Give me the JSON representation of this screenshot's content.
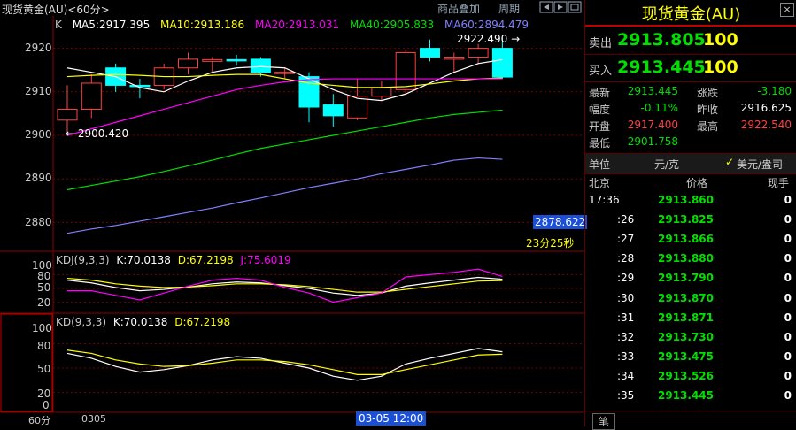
{
  "window": {
    "title": "现货黄金(AU)<60分>"
  },
  "toolbar": {
    "overlay_label": "商品叠加",
    "period_label": "周期"
  },
  "main_chart": {
    "k_label": "K",
    "ma_legend": [
      {
        "label": "MA5:2917.395",
        "color": "#ffffff"
      },
      {
        "label": "MA10:2913.186",
        "color": "#ffff00"
      },
      {
        "label": "MA20:2913.031",
        "color": "#ff00ff"
      },
      {
        "label": "MA40:2905.833",
        "color": "#00e000"
      },
      {
        "label": "MA60:2894.479",
        "color": "#8080ff"
      }
    ],
    "y_ticks": [
      "2920",
      "2910",
      "2900",
      "2890",
      "2880"
    ],
    "high_marker": "2922.490",
    "low_marker": "2900.420",
    "price_tag": "2878.622",
    "countdown": "23分25秒"
  },
  "kdj_panel": {
    "legend": [
      {
        "label": "KDJ(9,3,3)",
        "color": "#cccccc"
      },
      {
        "label": "K:70.0138",
        "color": "#ffffff"
      },
      {
        "label": "D:67.2198",
        "color": "#ffff00"
      },
      {
        "label": "J:75.6019",
        "color": "#ff00ff"
      }
    ],
    "y_ticks": [
      "100",
      "80",
      "50",
      "20"
    ]
  },
  "kd_panel": {
    "legend": [
      {
        "label": "KD(9,3,3)",
        "color": "#cccccc"
      },
      {
        "label": "K:70.0138",
        "color": "#ffffff"
      },
      {
        "label": "D:67.2198",
        "color": "#ffff00"
      }
    ],
    "y_ticks": [
      "100",
      "80",
      "50",
      "20",
      "0"
    ]
  },
  "x_axis": {
    "period": "60分",
    "date_label": "0305",
    "cursor_label": "03-05 12:00"
  },
  "quote": {
    "title": "现货黄金(AU)",
    "sell_label": "卖出",
    "sell_price": "2913.805",
    "sell_qty": "100",
    "buy_label": "买入",
    "buy_price": "2913.445",
    "buy_qty": "100",
    "stats": [
      {
        "l1": "最新",
        "v1": "2913.445",
        "c1": "#00e000",
        "l2": "涨跌",
        "v2": "-3.180",
        "c2": "#00e000"
      },
      {
        "l1": "幅度",
        "v1": "-0.11%",
        "c1": "#00e000",
        "l2": "昨收",
        "v2": "2916.625",
        "c2": "#ffffff"
      },
      {
        "l1": "开盘",
        "v1": "2917.400",
        "c1": "#ff4040",
        "l2": "最高",
        "v2": "2922.540",
        "c2": "#ff4040"
      },
      {
        "l1": "最低",
        "v1": "2901.758",
        "c1": "#00e000",
        "l2": "",
        "v2": "",
        "c2": "#ffffff"
      }
    ],
    "unit_label": "单位",
    "unit_value": "元/克",
    "usd_option": "美元/盎司",
    "ticks_header": {
      "time": "北京",
      "price": "价格",
      "vol": "现手"
    },
    "ticks": [
      {
        "time": "17:36",
        "price": "2913.860",
        "vol": "0"
      },
      {
        "time": ":26",
        "price": "2913.825",
        "vol": "0"
      },
      {
        "time": ":27",
        "price": "2913.866",
        "vol": "0"
      },
      {
        "time": ":28",
        "price": "2913.880",
        "vol": "0"
      },
      {
        "time": ":29",
        "price": "2913.790",
        "vol": "0"
      },
      {
        "time": ":30",
        "price": "2913.870",
        "vol": "0"
      },
      {
        "time": ":31",
        "price": "2913.871",
        "vol": "0"
      },
      {
        "time": ":32",
        "price": "2913.730",
        "vol": "0"
      },
      {
        "time": ":33",
        "price": "2913.475",
        "vol": "0"
      },
      {
        "time": ":34",
        "price": "2913.526",
        "vol": "0"
      },
      {
        "time": ":35",
        "price": "2913.445",
        "vol": "0"
      }
    ],
    "bottom_tab": "笔"
  },
  "colors": {
    "up": "#ff4040",
    "down": "#00ffff",
    "grid": "#7a0000",
    "axis": "#8b0000"
  },
  "chart_data": {
    "type": "candlestick",
    "title": "",
    "ylim": [
      2875,
      2925
    ],
    "candles": [
      {
        "o": 2903.5,
        "c": 2906.0,
        "h": 2911.5,
        "l": 2900.4
      },
      {
        "o": 2906.0,
        "c": 2912.0,
        "h": 2914.0,
        "l": 2904.0
      },
      {
        "o": 2915.5,
        "c": 2911.5,
        "h": 2916.5,
        "l": 2910.0
      },
      {
        "o": 2911.5,
        "c": 2911.2,
        "h": 2913.0,
        "l": 2908.5
      },
      {
        "o": 2911.5,
        "c": 2915.5,
        "h": 2916.5,
        "l": 2910.5
      },
      {
        "o": 2915.5,
        "c": 2917.5,
        "h": 2919.0,
        "l": 2914.0
      },
      {
        "o": 2917.0,
        "c": 2917.4,
        "h": 2918.0,
        "l": 2914.5
      },
      {
        "o": 2917.4,
        "c": 2917.2,
        "h": 2918.5,
        "l": 2916.0
      },
      {
        "o": 2917.5,
        "c": 2914.5,
        "h": 2918.0,
        "l": 2913.5
      },
      {
        "o": 2914.5,
        "c": 2914.5,
        "h": 2915.5,
        "l": 2913.0
      },
      {
        "o": 2913.5,
        "c": 2906.5,
        "h": 2914.5,
        "l": 2903.0
      },
      {
        "o": 2907.0,
        "c": 2904.5,
        "h": 2909.5,
        "l": 2902.0
      },
      {
        "o": 2904.0,
        "c": 2909.0,
        "h": 2913.0,
        "l": 2903.5
      },
      {
        "o": 2909.0,
        "c": 2911.0,
        "h": 2912.5,
        "l": 2908.0
      },
      {
        "o": 2910.5,
        "c": 2919.0,
        "h": 2919.5,
        "l": 2909.5
      },
      {
        "o": 2920.0,
        "c": 2918.0,
        "h": 2922.0,
        "l": 2917.0
      },
      {
        "o": 2917.5,
        "c": 2918.0,
        "h": 2919.0,
        "l": 2914.5
      },
      {
        "o": 2918.0,
        "c": 2920.0,
        "h": 2921.0,
        "l": 2916.5
      },
      {
        "o": 2920.0,
        "c": 2913.4,
        "h": 2922.5,
        "l": 2913.0
      }
    ],
    "ma": [
      {
        "name": "MA5",
        "color": "#ffffff",
        "values": [
          2915.5,
          2914.5,
          2913.5,
          2911.0,
          2910.0,
          2912.5,
          2914.5,
          2915.5,
          2915.8,
          2915.5,
          2913.0,
          2910.5,
          2908.5,
          2908.0,
          2909.5,
          2912.0,
          2914.5,
          2916.5,
          2917.4
        ]
      },
      {
        "name": "MA10",
        "color": "#ffff00",
        "values": [
          2913.5,
          2913.8,
          2914.0,
          2913.8,
          2913.5,
          2913.5,
          2913.8,
          2914.0,
          2914.0,
          2913.0,
          2912.0,
          2911.5,
          2911.0,
          2911.0,
          2911.2,
          2911.8,
          2912.5,
          2913.0,
          2913.2
        ]
      },
      {
        "name": "MA20",
        "color": "#ff00ff",
        "values": [
          2900.0,
          2901.5,
          2903.0,
          2904.5,
          2906.0,
          2907.5,
          2909.0,
          2910.5,
          2911.5,
          2912.3,
          2912.8,
          2913.0,
          2913.0,
          2913.0,
          2913.0,
          2913.0,
          2913.0,
          2913.0,
          2913.0
        ]
      },
      {
        "name": "MA40",
        "color": "#00e000",
        "values": [
          2887.5,
          2888.5,
          2889.5,
          2890.5,
          2891.7,
          2893.0,
          2894.3,
          2895.7,
          2897.0,
          2898.0,
          2899.0,
          2900.0,
          2901.0,
          2902.0,
          2903.0,
          2904.0,
          2904.8,
          2905.3,
          2905.8
        ]
      },
      {
        "name": "MA60",
        "color": "#8080ff",
        "values": [
          2877.5,
          2878.5,
          2879.3,
          2880.3,
          2881.3,
          2882.3,
          2883.3,
          2884.5,
          2885.6,
          2886.8,
          2888.0,
          2889.0,
          2890.0,
          2891.2,
          2892.2,
          2893.2,
          2894.3,
          2894.8,
          2894.5
        ]
      }
    ],
    "kdj": [
      {
        "name": "K",
        "color": "#ffffff",
        "values": [
          68,
          62,
          52,
          45,
          48,
          53,
          60,
          64,
          62,
          56,
          50,
          40,
          35,
          40,
          55,
          62,
          68,
          74,
          70
        ]
      },
      {
        "name": "D",
        "color": "#ffff00",
        "values": [
          72,
          68,
          60,
          55,
          52,
          53,
          56,
          60,
          60,
          58,
          54,
          48,
          42,
          42,
          48,
          54,
          60,
          66,
          67
        ]
      },
      {
        "name": "J",
        "color": "#ff00ff",
        "values": [
          45,
          45,
          35,
          25,
          40,
          55,
          68,
          72,
          68,
          52,
          40,
          20,
          30,
          40,
          75,
          80,
          85,
          92,
          76
        ]
      }
    ],
    "kd": [
      {
        "name": "K",
        "color": "#ffffff",
        "values": [
          68,
          62,
          52,
          45,
          48,
          53,
          60,
          64,
          62,
          56,
          50,
          40,
          35,
          40,
          55,
          62,
          68,
          74,
          70
        ]
      },
      {
        "name": "D",
        "color": "#ffff00",
        "values": [
          72,
          68,
          60,
          55,
          52,
          53,
          56,
          60,
          60,
          58,
          54,
          48,
          42,
          42,
          48,
          54,
          60,
          66,
          67
        ]
      }
    ]
  }
}
